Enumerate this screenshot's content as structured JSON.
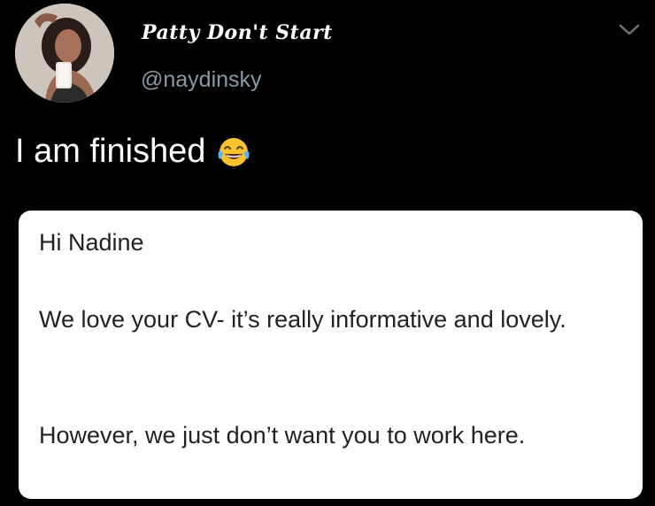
{
  "author": {
    "display_name": "Patty Don't Start",
    "handle": "@naydinsky"
  },
  "tweet": {
    "text": "I am finished",
    "emoji": "face-with-tears-of-joy"
  },
  "email_card": {
    "greeting": "Hi Nadine",
    "paragraph_1": "We love your CV- it’s really informative and lovely.",
    "paragraph_2": "However, we just don’t want you to work here."
  },
  "colors": {
    "background": "#000000",
    "name_text": "#ffffff",
    "handle_text": "#8899a6",
    "card_background": "#ffffff",
    "card_text": "#222222"
  },
  "icons": {
    "menu": "chevron-down-icon"
  }
}
